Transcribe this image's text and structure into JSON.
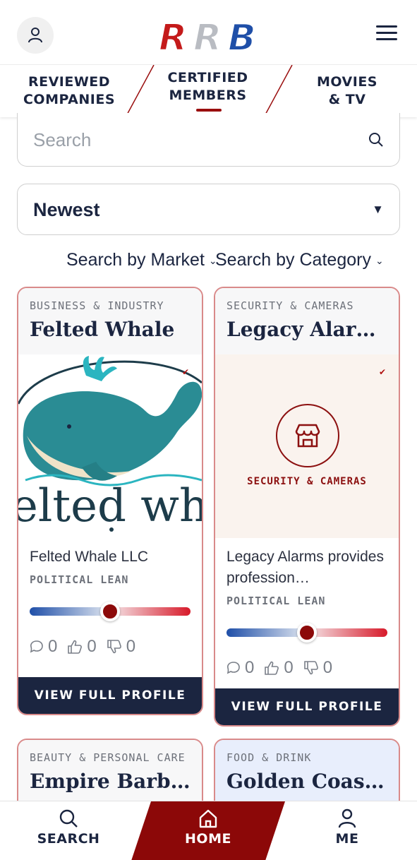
{
  "header": {
    "logo_text": "RRB",
    "avatar_icon": "user-icon",
    "menu_icon": "hamburger-icon"
  },
  "tabs": [
    {
      "line1": "REVIEWED",
      "line2": "COMPANIES"
    },
    {
      "line1": "CERTIFIED",
      "line2": "MEMBERS",
      "active": true
    },
    {
      "line1": "MOVIES",
      "line2": "& TV"
    }
  ],
  "search": {
    "placeholder": "Search",
    "value": ""
  },
  "sort": {
    "selected": "Newest",
    "arrow": "▼"
  },
  "filters": {
    "market": "Search by Market",
    "category": "Search by Category"
  },
  "cards": [
    {
      "category": "BUSINESS & INDUSTRY",
      "title": "Felted Whale",
      "image_text": "elted wha",
      "description": "Felted Whale LLC",
      "lean_label": "POLITICAL LEAN",
      "lean_value": 0.5,
      "comments": "0",
      "likes": "0",
      "dislikes": "0",
      "button": "VIEW FULL PROFILE"
    },
    {
      "category": "SECURITY & CAMERAS",
      "title": "Legacy Alarms",
      "media_category": "SECURITY & CAMERAS",
      "description": "Legacy Alarms provides profession…",
      "lean_label": "POLITICAL LEAN",
      "lean_value": 0.5,
      "comments": "0",
      "likes": "0",
      "dislikes": "0",
      "button": "VIEW FULL PROFILE"
    },
    {
      "category": "BEAUTY & PERSONAL CARE",
      "title": "Empire Barbe…"
    },
    {
      "category": "FOOD & DRINK",
      "title": "Golden Coast…"
    }
  ],
  "bottom_nav": {
    "search": "SEARCH",
    "home": "HOME",
    "me": "ME"
  },
  "colors": {
    "navy": "#1b2540",
    "accent_red": "#9a0e0e",
    "card_border": "#d98a8a"
  }
}
